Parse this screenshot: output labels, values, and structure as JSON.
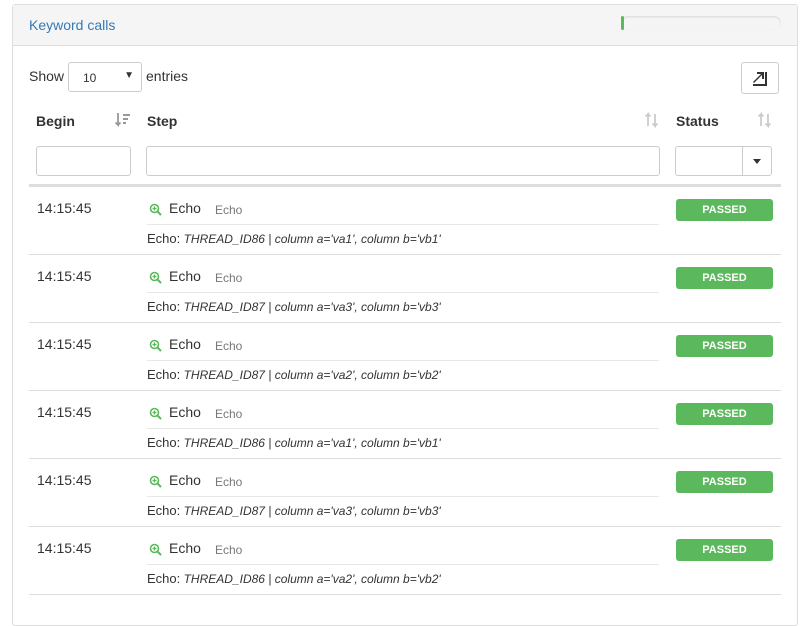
{
  "panel": {
    "title": "Keyword calls",
    "progress_fraction": 0.02,
    "progress_color": "#5cb85c"
  },
  "controls": {
    "show_label": "Show",
    "entries_value": "10",
    "entries_label": "entries",
    "export_icon": "export-icon"
  },
  "table": {
    "headers": {
      "begin": "Begin",
      "step": "Step",
      "status": "Status"
    },
    "sort_icons": {
      "begin": "sort-amount-desc-icon",
      "step": "sort-icon",
      "status": "sort-icon"
    },
    "status_color": "#5cb85c",
    "rows": [
      {
        "begin": "14:15:45",
        "keyword": "Echo",
        "library": "Echo",
        "args_label": "Echo:",
        "args": "THREAD_ID86 | column a='va1', column b='vb1'",
        "status": "PASSED"
      },
      {
        "begin": "14:15:45",
        "keyword": "Echo",
        "library": "Echo",
        "args_label": "Echo:",
        "args": "THREAD_ID87 | column a='va3', column b='vb3'",
        "status": "PASSED"
      },
      {
        "begin": "14:15:45",
        "keyword": "Echo",
        "library": "Echo",
        "args_label": "Echo:",
        "args": "THREAD_ID87 | column a='va2', column b='vb2'",
        "status": "PASSED"
      },
      {
        "begin": "14:15:45",
        "keyword": "Echo",
        "library": "Echo",
        "args_label": "Echo:",
        "args": "THREAD_ID86 | column a='va1', column b='vb1'",
        "status": "PASSED"
      },
      {
        "begin": "14:15:45",
        "keyword": "Echo",
        "library": "Echo",
        "args_label": "Echo:",
        "args": "THREAD_ID87 | column a='va3', column b='vb3'",
        "status": "PASSED"
      },
      {
        "begin": "14:15:45",
        "keyword": "Echo",
        "library": "Echo",
        "args_label": "Echo:",
        "args": "THREAD_ID86 | column a='va2', column b='vb2'",
        "status": "PASSED"
      }
    ]
  }
}
